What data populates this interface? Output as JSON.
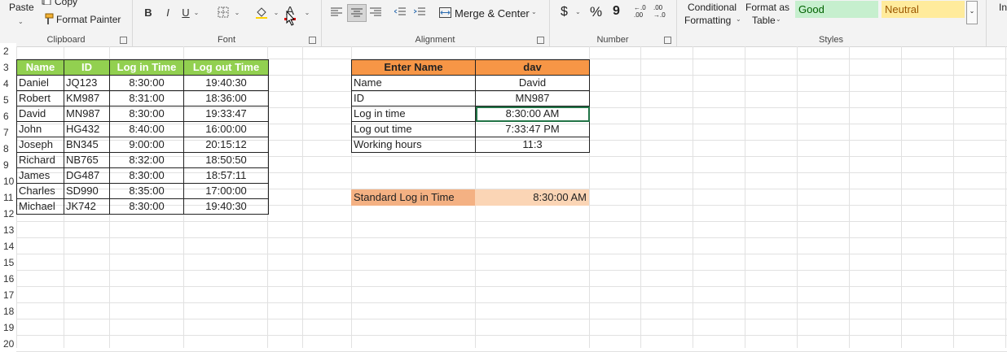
{
  "ribbon": {
    "clipboard": {
      "paste": "Paste",
      "copy": "Copy",
      "format_painter": "Format Painter",
      "label": "Clipboard"
    },
    "font": {
      "bold": "B",
      "italic": "I",
      "underline": "U",
      "font_color": "A",
      "label": "Font"
    },
    "alignment": {
      "merge_center": "Merge & Center",
      "label": "Alignment"
    },
    "number": {
      "currency": "$",
      "percent": "%",
      "comma": "9",
      "inc_decimal": "←.0 .00",
      "dec_decimal": ".00 →.0",
      "label": "Number"
    },
    "styles": {
      "conditional_1": "Conditional",
      "conditional_2": "Formatting",
      "format_as_1": "Format as",
      "format_as_2": "Table",
      "good": "Good",
      "neutral": "Neutral",
      "label": "Styles"
    },
    "insert_partial": "In"
  },
  "rows": [
    "2",
    "3",
    "4",
    "5",
    "6",
    "7",
    "8",
    "9",
    "10",
    "11",
    "12",
    "13",
    "14",
    "15",
    "16",
    "17",
    "18",
    "19",
    "20"
  ],
  "table1": {
    "headers": [
      "Name",
      "ID",
      "Log in Time",
      "Log out Time"
    ],
    "rows": [
      [
        "Daniel",
        "JQ123",
        "8:30:00",
        "19:40:30"
      ],
      [
        "Robert",
        "KM987",
        "8:31:00",
        "18:36:00"
      ],
      [
        "David",
        "MN987",
        "8:30:00",
        "19:33:47"
      ],
      [
        "John",
        "HG432",
        "8:40:00",
        "16:00:00"
      ],
      [
        "Joseph",
        "BN345",
        "9:00:00",
        "20:15:12"
      ],
      [
        "Richard",
        "NB765",
        "8:32:00",
        "18:50:50"
      ],
      [
        "James",
        "DG487",
        "8:30:00",
        "18:57:11"
      ],
      [
        "Charles",
        "SD990",
        "8:35:00",
        "17:00:00"
      ],
      [
        "Michael",
        "JK742",
        "8:30:00",
        "19:40:30"
      ]
    ]
  },
  "table2": {
    "header_label": "Enter Name",
    "header_value": "dav",
    "rows": [
      [
        "Name",
        "David"
      ],
      [
        "ID",
        "MN987"
      ],
      [
        "Log in time",
        "8:30:00 AM"
      ],
      [
        "Log out time",
        "7:33:47 PM"
      ],
      [
        "Working hours",
        "11:3"
      ]
    ]
  },
  "standard": {
    "label": "Standard Log in Time",
    "value": "8:30:00 AM"
  },
  "colors": {
    "green_header": "#92d050",
    "orange_header": "#f79646",
    "standard_label": "#f4b183",
    "standard_value": "#fbd5b5",
    "good_bg": "#c6efce",
    "neutral_bg": "#ffeb9c"
  }
}
